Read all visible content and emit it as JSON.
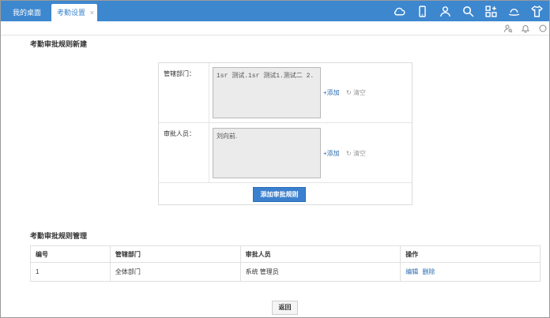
{
  "tabs": {
    "desktop_label": "我的桌面",
    "attendance_label": "考勤设置",
    "close_glyph": "×"
  },
  "top_icons": [
    "cloud-icon",
    "phone-icon",
    "user-icon",
    "search-icon",
    "apps-icon",
    "hat-icon",
    "shirt-icon"
  ],
  "sub_icons": [
    "user-search-icon",
    "bell-icon",
    "circle-icon"
  ],
  "colors": {
    "topbar": "#3d87cf",
    "primary_button": "#3a80cf",
    "link": "#2a6cb0"
  },
  "new_rule": {
    "title": "考勤审批规则新建",
    "dept_label": "管辖部门：",
    "dept_value": "1sr 测试.1sr  测试1.测试二  2.",
    "approver_label": "审批人员：",
    "approver_value": "刘向前.",
    "add_label": "+添加",
    "clear_label": "清空",
    "submit_label": "添加审批规则"
  },
  "manage": {
    "title": "考勤审批规则管理",
    "columns": [
      "编号",
      "管辖部门",
      "审批人员",
      "操作"
    ],
    "rows": [
      {
        "id": "1",
        "dept": "全体部门",
        "approver": "系统 管理员",
        "edit": "编辑",
        "delete": "删除"
      }
    ]
  },
  "back_label": "返回"
}
